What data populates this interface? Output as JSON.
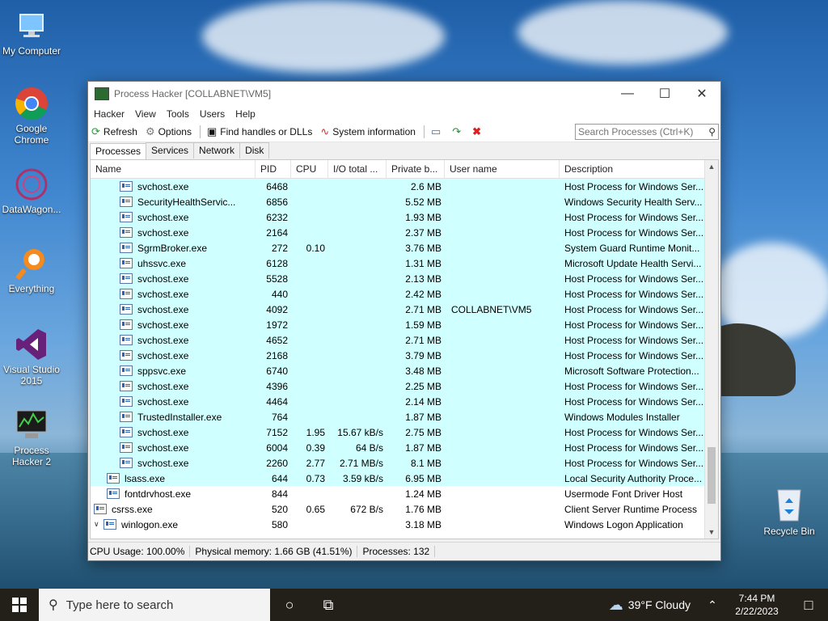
{
  "desktop": {
    "icons": [
      {
        "label": "My Computer"
      },
      {
        "label": "Google Chrome"
      },
      {
        "label": "DataWagon..."
      },
      {
        "label": "Everything"
      },
      {
        "label": "Visual Studio 2015"
      },
      {
        "label": "Process Hacker 2"
      }
    ],
    "recycle_bin": "Recycle Bin"
  },
  "window": {
    "title": "Process Hacker [COLLABNET\\VM5]",
    "menu": [
      "Hacker",
      "View",
      "Tools",
      "Users",
      "Help"
    ],
    "toolbar": {
      "refresh": "Refresh",
      "options": "Options",
      "find": "Find handles or DLLs",
      "sysinfo": "System information"
    },
    "search_placeholder": "Search Processes (Ctrl+K)",
    "tabs": [
      "Processes",
      "Services",
      "Network",
      "Disk"
    ],
    "columns": [
      "Name",
      "PID",
      "CPU",
      "I/O total ...",
      "Private b...",
      "User name",
      "Description"
    ],
    "rows": [
      {
        "name": "svchost.exe",
        "pid": "6468",
        "cpu": "",
        "io": "",
        "priv": "2.6 MB",
        "user": "",
        "desc": "Host Process for Windows Ser...",
        "level": 3,
        "svc": true
      },
      {
        "name": "SecurityHealthServic...",
        "pid": "6856",
        "cpu": "",
        "io": "",
        "priv": "5.52 MB",
        "user": "",
        "desc": "Windows Security Health Serv...",
        "level": 3,
        "svc": true
      },
      {
        "name": "svchost.exe",
        "pid": "6232",
        "cpu": "",
        "io": "",
        "priv": "1.93 MB",
        "user": "",
        "desc": "Host Process for Windows Ser...",
        "level": 3,
        "svc": true
      },
      {
        "name": "svchost.exe",
        "pid": "2164",
        "cpu": "",
        "io": "",
        "priv": "2.37 MB",
        "user": "",
        "desc": "Host Process for Windows Ser...",
        "level": 3,
        "svc": true
      },
      {
        "name": "SgrmBroker.exe",
        "pid": "272",
        "cpu": "0.10",
        "io": "",
        "priv": "3.76 MB",
        "user": "",
        "desc": "System Guard Runtime Monit...",
        "level": 3,
        "svc": true
      },
      {
        "name": "uhssvc.exe",
        "pid": "6128",
        "cpu": "",
        "io": "",
        "priv": "1.31 MB",
        "user": "",
        "desc": "Microsoft Update Health Servi...",
        "level": 3,
        "svc": true
      },
      {
        "name": "svchost.exe",
        "pid": "5528",
        "cpu": "",
        "io": "",
        "priv": "2.13 MB",
        "user": "",
        "desc": "Host Process for Windows Ser...",
        "level": 3,
        "svc": true
      },
      {
        "name": "svchost.exe",
        "pid": "440",
        "cpu": "",
        "io": "",
        "priv": "2.42 MB",
        "user": "",
        "desc": "Host Process for Windows Ser...",
        "level": 3,
        "svc": true
      },
      {
        "name": "svchost.exe",
        "pid": "4092",
        "cpu": "",
        "io": "",
        "priv": "2.71 MB",
        "user": "COLLABNET\\VM5",
        "desc": "Host Process for Windows Ser...",
        "level": 3,
        "svc": true
      },
      {
        "name": "svchost.exe",
        "pid": "1972",
        "cpu": "",
        "io": "",
        "priv": "1.59 MB",
        "user": "",
        "desc": "Host Process for Windows Ser...",
        "level": 3,
        "svc": true
      },
      {
        "name": "svchost.exe",
        "pid": "4652",
        "cpu": "",
        "io": "",
        "priv": "2.71 MB",
        "user": "",
        "desc": "Host Process for Windows Ser...",
        "level": 3,
        "svc": true
      },
      {
        "name": "svchost.exe",
        "pid": "2168",
        "cpu": "",
        "io": "",
        "priv": "3.79 MB",
        "user": "",
        "desc": "Host Process for Windows Ser...",
        "level": 3,
        "svc": true
      },
      {
        "name": "sppsvc.exe",
        "pid": "6740",
        "cpu": "",
        "io": "",
        "priv": "3.48 MB",
        "user": "",
        "desc": "Microsoft Software Protection...",
        "level": 3,
        "svc": true
      },
      {
        "name": "svchost.exe",
        "pid": "4396",
        "cpu": "",
        "io": "",
        "priv": "2.25 MB",
        "user": "",
        "desc": "Host Process for Windows Ser...",
        "level": 3,
        "svc": true
      },
      {
        "name": "svchost.exe",
        "pid": "4464",
        "cpu": "",
        "io": "",
        "priv": "2.14 MB",
        "user": "",
        "desc": "Host Process for Windows Ser...",
        "level": 3,
        "svc": true
      },
      {
        "name": "TrustedInstaller.exe",
        "pid": "764",
        "cpu": "",
        "io": "",
        "priv": "1.87 MB",
        "user": "",
        "desc": "Windows Modules Installer",
        "level": 3,
        "svc": true
      },
      {
        "name": "svchost.exe",
        "pid": "7152",
        "cpu": "1.95",
        "io": "15.67 kB/s",
        "priv": "2.75 MB",
        "user": "",
        "desc": "Host Process for Windows Ser...",
        "level": 3,
        "svc": true
      },
      {
        "name": "svchost.exe",
        "pid": "6004",
        "cpu": "0.39",
        "io": "64 B/s",
        "priv": "1.87 MB",
        "user": "",
        "desc": "Host Process for Windows Ser...",
        "level": 3,
        "svc": true
      },
      {
        "name": "svchost.exe",
        "pid": "2260",
        "cpu": "2.77",
        "io": "2.71 MB/s",
        "priv": "8.1 MB",
        "user": "",
        "desc": "Host Process for Windows Ser...",
        "level": 3,
        "svc": true
      },
      {
        "name": "lsass.exe",
        "pid": "644",
        "cpu": "0.73",
        "io": "3.59 kB/s",
        "priv": "6.95 MB",
        "user": "",
        "desc": "Local Security Authority Proce...",
        "level": 2,
        "svc": true
      },
      {
        "name": "fontdrvhost.exe",
        "pid": "844",
        "cpu": "",
        "io": "",
        "priv": "1.24 MB",
        "user": "",
        "desc": "Usermode Font Driver Host",
        "level": 2,
        "svc": false
      },
      {
        "name": "csrss.exe",
        "pid": "520",
        "cpu": "0.65",
        "io": "672 B/s",
        "priv": "1.76 MB",
        "user": "",
        "desc": "Client Server Runtime Process",
        "level": 1,
        "svc": false
      },
      {
        "name": "winlogon.exe",
        "pid": "580",
        "cpu": "",
        "io": "",
        "priv": "3.18 MB",
        "user": "",
        "desc": "Windows Logon Application",
        "level": 1,
        "svc": false,
        "expanded": true
      }
    ],
    "status": {
      "cpu": "CPU Usage: 100.00%",
      "mem": "Physical memory: 1.66 GB (41.51%)",
      "procs": "Processes: 132"
    }
  },
  "taskbar": {
    "search_placeholder": "Type here to search",
    "weather": "39°F  Cloudy",
    "time": "7:44 PM",
    "date": "2/22/2023"
  },
  "colors": {
    "service_row": "#d0ffff",
    "taskbar": "#23201a"
  }
}
